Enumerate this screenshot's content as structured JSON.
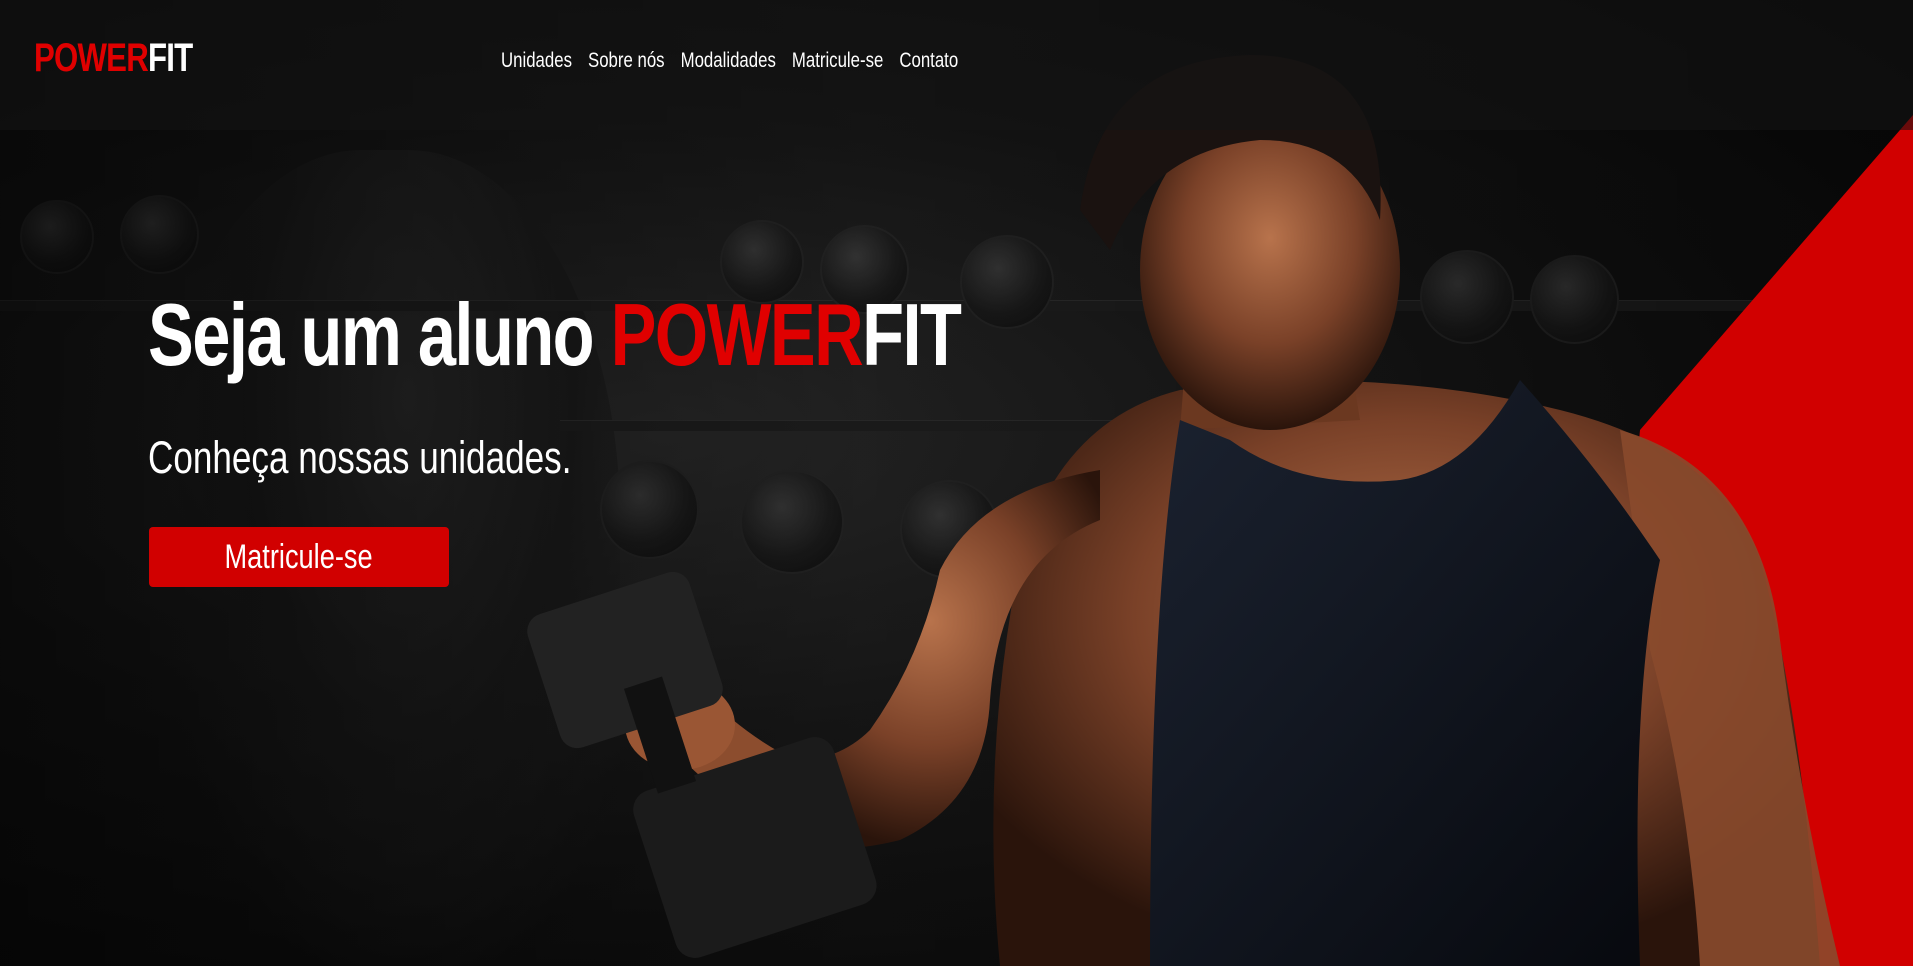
{
  "brand": {
    "logo_part1": "POWER",
    "logo_part2": "FIT",
    "accent_color": "#e00000"
  },
  "nav": {
    "items": [
      {
        "label": "Unidades"
      },
      {
        "label": "Sobre nós"
      },
      {
        "label": "Modalidades"
      },
      {
        "label": "Matricule-se"
      },
      {
        "label": "Contato"
      }
    ]
  },
  "hero": {
    "title_prefix": "Seja um aluno ",
    "title_brand_part1": "POWER",
    "title_brand_part2": "FIT",
    "subtitle": "Conheça nossas unidades.",
    "cta_label": "Matricule-se"
  },
  "images": {
    "background": "dark-gym-background",
    "athlete": "athlete-lifting-dumbbell",
    "dumbbell_icon": "dumbbell-icon"
  }
}
